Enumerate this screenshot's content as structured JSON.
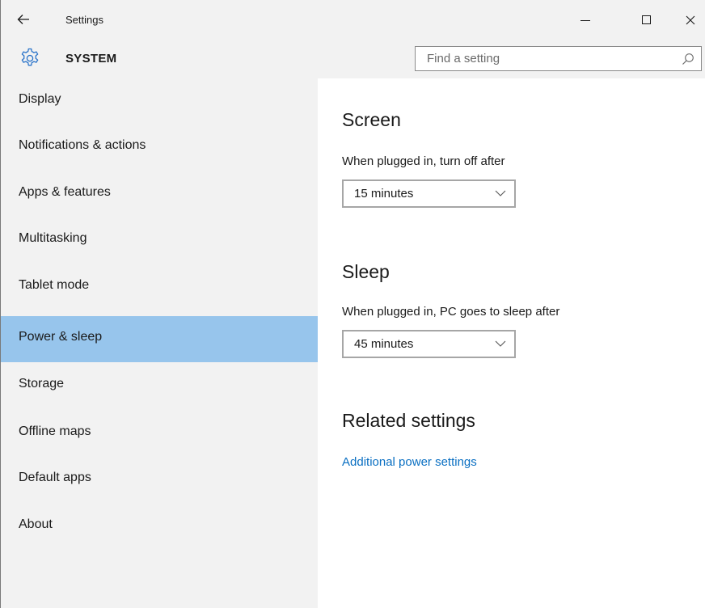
{
  "window": {
    "title": "Settings"
  },
  "header": {
    "section": "SYSTEM",
    "search_placeholder": "Find a setting"
  },
  "sidebar": {
    "items": [
      {
        "label": "Display"
      },
      {
        "label": "Notifications & actions"
      },
      {
        "label": "Apps & features"
      },
      {
        "label": "Multitasking"
      },
      {
        "label": "Tablet mode"
      },
      {
        "label": "Power & sleep",
        "selected": true
      },
      {
        "label": "Storage"
      },
      {
        "label": "Offline maps"
      },
      {
        "label": "Default apps"
      },
      {
        "label": "About"
      }
    ]
  },
  "screen": {
    "heading": "Screen",
    "label": "When plugged in, turn off after",
    "value": "15 minutes"
  },
  "sleep": {
    "heading": "Sleep",
    "label": "When plugged in, PC goes to sleep after",
    "value": "45 minutes"
  },
  "related": {
    "heading": "Related settings",
    "link": "Additional power settings"
  },
  "colors": {
    "selected_nav": "#97c5ec",
    "link": "#0a6fc2",
    "chrome": "#f2f2f2",
    "gear_icon": "#2a73c9"
  },
  "icons": {
    "back": "back-arrow-icon",
    "minimize": "minimize-icon",
    "maximize": "maximize-icon",
    "close": "close-icon",
    "gear": "gear-icon",
    "search": "search-icon",
    "dropdown": "chevron-down-icon"
  }
}
